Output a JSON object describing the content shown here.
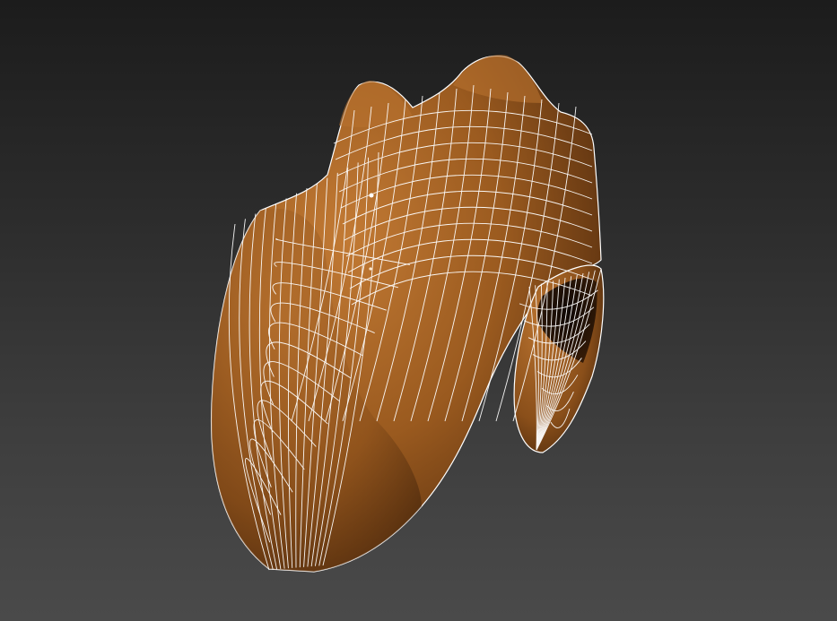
{
  "viewport": {
    "object": "controller-shell",
    "display_mode": "smooth-shaded-with-wireframe",
    "colors": {
      "background_top": "#1c1c1c",
      "background_bottom": "#4a4a4a",
      "surface_highlight": "#c27a34",
      "surface_mid": "#9a5a1f",
      "surface_shadow": "#3a1e08",
      "wireframe": "#ffffff"
    }
  }
}
